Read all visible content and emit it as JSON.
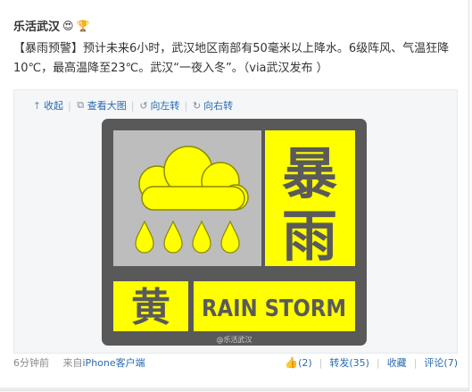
{
  "post": {
    "author": "乐活武汉",
    "badges": [
      "face-emoji-icon",
      "trophy-badge-icon"
    ],
    "text": "【暴雨预警】预计未来6小时，武汉地区南部有50毫米以上降水。6级阵风、气温狂降10℃，最高温降至23℃。武汉“一夜入冬”。（via武汉发布 ）"
  },
  "media": {
    "tools": [
      {
        "icon": "arrow-up-icon",
        "label": "收起"
      },
      {
        "icon": "external-link-icon",
        "label": "查看大图"
      },
      {
        "icon": "rotate-left-icon",
        "label": "向左转"
      },
      {
        "icon": "rotate-right-icon",
        "label": "向右转"
      }
    ],
    "image": {
      "big_text_top": "暴",
      "big_text_bottom": "雨",
      "level_char": "黄",
      "caption": "RAIN STORM",
      "watermark": "@乐活武汉",
      "colors": {
        "yellow": "#ffff00",
        "gray": "#5a5a5a",
        "light": "#bdbdbd"
      }
    }
  },
  "footer": {
    "time": "6分钟前",
    "source_prefix": "来自",
    "source_link": "iPhone客户端",
    "like_count": "(2)",
    "forward_label": "转发(35)",
    "favorite_label": "收藏",
    "comment_label": "评论(7)"
  },
  "colors": {
    "link": "#2a6ab0",
    "text": "#333333",
    "muted": "#8a8a8a"
  }
}
